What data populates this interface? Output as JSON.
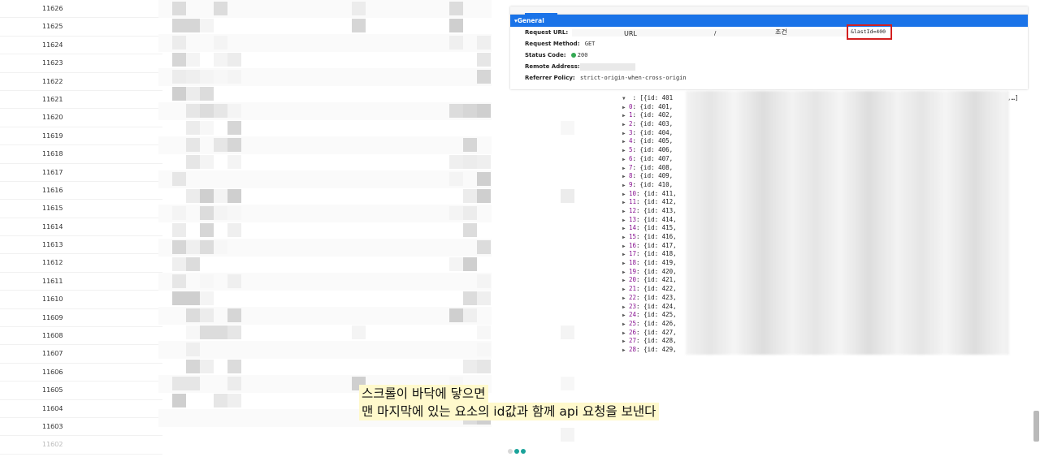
{
  "list": {
    "rows": [
      "11626",
      "11625",
      "11624",
      "11623",
      "11622",
      "11621",
      "11620",
      "11619",
      "11618",
      "11617",
      "11616",
      "11615",
      "11614",
      "11613",
      "11612",
      "11611",
      "11610",
      "11609",
      "11608",
      "11607",
      "11606",
      "11605",
      "11604",
      "11603",
      "11602"
    ]
  },
  "devtools": {
    "section_title": "General",
    "request_url_label": "Request URL:",
    "url_annotation": "URL",
    "slash": "/",
    "condition_annotation": "조건",
    "last_id_param": "&lastId=400",
    "request_method_label": "Request Method:",
    "request_method_value": "GET",
    "status_code_label": "Status Code:",
    "status_code_value": "200",
    "remote_address_label": "Remote Address:",
    "referrer_policy_label": "Referrer Policy:",
    "referrer_policy_value": "strict-origin-when-cross-origin",
    "status_color": "#34a853",
    "accent_color": "#1a73e8",
    "highlight_color": "#d32020"
  },
  "response": {
    "head": ": [{id: 401",
    "head_end": ",…]",
    "items": [
      {
        "index": "0",
        "text": "{id: 401,"
      },
      {
        "index": "1",
        "text": "{id: 402,"
      },
      {
        "index": "2",
        "text": "{id: 403,"
      },
      {
        "index": "3",
        "text": "{id: 404,"
      },
      {
        "index": "4",
        "text": "{id: 405,"
      },
      {
        "index": "5",
        "text": "{id: 406,"
      },
      {
        "index": "6",
        "text": "{id: 407,"
      },
      {
        "index": "7",
        "text": "{id: 408,"
      },
      {
        "index": "8",
        "text": "{id: 409,"
      },
      {
        "index": "9",
        "text": "{id: 410,"
      },
      {
        "index": "10",
        "text": "{id: 411,"
      },
      {
        "index": "11",
        "text": "{id: 412,"
      },
      {
        "index": "12",
        "text": "{id: 413,"
      },
      {
        "index": "13",
        "text": "{id: 414,"
      },
      {
        "index": "14",
        "text": "{id: 415,"
      },
      {
        "index": "15",
        "text": "{id: 416,"
      },
      {
        "index": "16",
        "text": "{id: 417,"
      },
      {
        "index": "17",
        "text": "{id: 418,"
      },
      {
        "index": "18",
        "text": "{id: 419,"
      },
      {
        "index": "19",
        "text": "{id: 420,"
      },
      {
        "index": "20",
        "text": "{id: 421,"
      },
      {
        "index": "21",
        "text": "{id: 422,"
      },
      {
        "index": "22",
        "text": "{id: 423,"
      },
      {
        "index": "23",
        "text": "{id: 424,"
      },
      {
        "index": "24",
        "text": "{id: 425,"
      },
      {
        "index": "25",
        "text": "{id: 426,"
      },
      {
        "index": "26",
        "text": "{id: 427,"
      },
      {
        "index": "27",
        "text": "{id: 428,"
      },
      {
        "index": "28",
        "text": "{id: 429,"
      }
    ]
  },
  "caption": {
    "line1": "스크롤이 바닥에 닿으면",
    "line2": "맨 마지막에 있는 요소의 id값과 함께 api 요청을 보낸다"
  },
  "icons": {
    "expand": "expand-triangle-icon",
    "collapse": "collapse-triangle-icon"
  }
}
